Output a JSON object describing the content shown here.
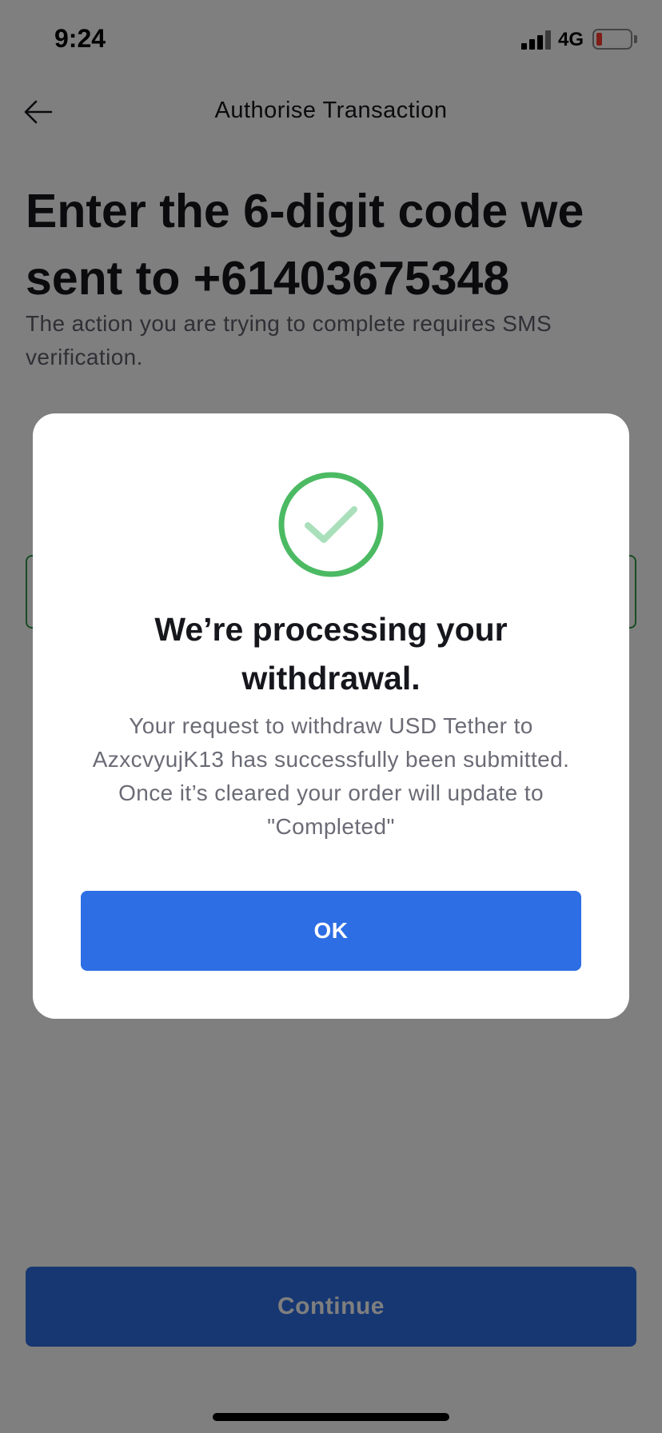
{
  "status_bar": {
    "time": "9:24",
    "network": "4G",
    "icons": [
      "cellular-signal-icon",
      "battery-low-icon"
    ]
  },
  "header": {
    "title": "Authorise Transaction",
    "back_icon": "arrow-left-icon"
  },
  "content": {
    "heading": "Enter the 6-digit code we sent to +61403675348",
    "description": "The action you are trying to complete requires SMS verification.",
    "continue_label": "Continue"
  },
  "modal": {
    "icon": "check-circle-icon",
    "title": "We’re processing your withdrawal.",
    "message": "Your request to withdraw USD Tether to AzxcvyujK13 has successfully been submitted. Once it’s cleared your order will update to \"Completed\"",
    "ok_label": "OK"
  },
  "colors": {
    "accent": "#2d6ee4",
    "success": "#4cba63",
    "success_check": "#a9e0bb",
    "overlay": "rgba(0,0,0,0.5)"
  }
}
